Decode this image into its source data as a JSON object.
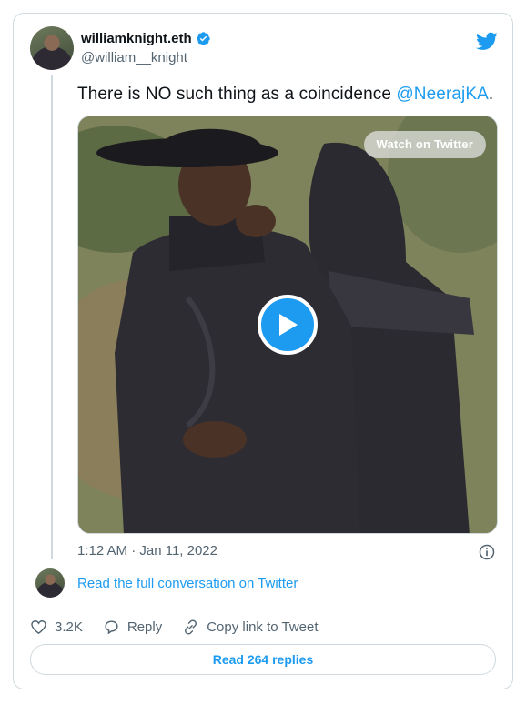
{
  "author": {
    "display_name": "williamknight.eth",
    "handle": "@william__knight",
    "verified": true
  },
  "tweet": {
    "text": "There is NO such thing as a coincidence ",
    "mention": "@NeerajKA",
    "trailing": ".",
    "timestamp": "1:12 AM · Jan 11, 2022"
  },
  "media": {
    "watch_label": "Watch on Twitter",
    "play_icon": "play-icon"
  },
  "conversation": {
    "link_label": "Read the full conversation on Twitter"
  },
  "actions": {
    "like_count": "3.2K",
    "reply_label": "Reply",
    "copy_label": "Copy link to Tweet"
  },
  "replies_button": "Read 264 replies",
  "colors": {
    "accent": "#1d9bf0",
    "text_secondary": "#536471",
    "border": "#cfd9de"
  }
}
